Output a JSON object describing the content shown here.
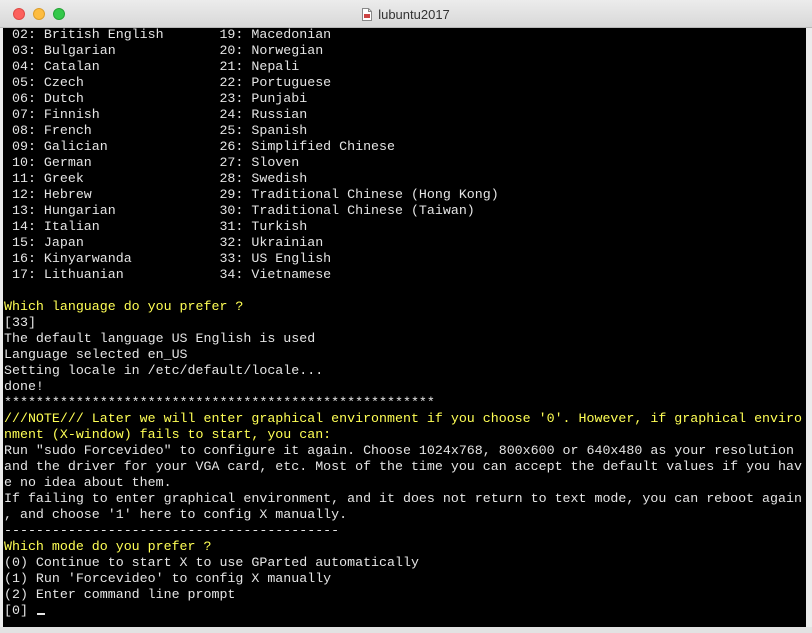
{
  "window": {
    "title": "lubuntu2017"
  },
  "terminal": {
    "lines": [
      {
        "text": " 02: British English       19: Macedonian",
        "color": "normal"
      },
      {
        "text": " 03: Bulgarian             20: Norwegian",
        "color": "normal"
      },
      {
        "text": " 04: Catalan               21: Nepali",
        "color": "normal"
      },
      {
        "text": " 05: Czech                 22: Portuguese",
        "color": "normal"
      },
      {
        "text": " 06: Dutch                 23: Punjabi",
        "color": "normal"
      },
      {
        "text": " 07: Finnish               24: Russian",
        "color": "normal"
      },
      {
        "text": " 08: French                25: Spanish",
        "color": "normal"
      },
      {
        "text": " 09: Galician              26: Simplified Chinese",
        "color": "normal"
      },
      {
        "text": " 10: German                27: Sloven",
        "color": "normal"
      },
      {
        "text": " 11: Greek                 28: Swedish",
        "color": "normal"
      },
      {
        "text": " 12: Hebrew                29: Traditional Chinese (Hong Kong)",
        "color": "normal"
      },
      {
        "text": " 13: Hungarian             30: Traditional Chinese (Taiwan)",
        "color": "normal"
      },
      {
        "text": " 14: Italian               31: Turkish",
        "color": "normal"
      },
      {
        "text": " 15: Japan                 32: Ukrainian",
        "color": "normal"
      },
      {
        "text": " 16: Kinyarwanda           33: US English",
        "color": "normal"
      },
      {
        "text": " 17: Lithuanian            34: Vietnamese",
        "color": "normal"
      },
      {
        "text": "",
        "color": "normal"
      },
      {
        "text": "Which language do you prefer ?",
        "color": "yellow"
      },
      {
        "text": "[33]",
        "color": "normal"
      },
      {
        "text": "The default language US English is used",
        "color": "normal"
      },
      {
        "text": "Language selected en_US",
        "color": "normal"
      },
      {
        "text": "Setting locale in /etc/default/locale...",
        "color": "normal"
      },
      {
        "text": "done!",
        "color": "normal"
      },
      {
        "text": "******************************************************",
        "color": "normal"
      },
      {
        "text": "///NOTE/// Later we will enter graphical environment if you choose '0'. However, if graphical enviro",
        "color": "yellow"
      },
      {
        "text": "nment (X-window) fails to start, you can:",
        "color": "yellow"
      },
      {
        "text": "Run \"sudo Forcevideo\" to configure it again. Choose 1024x768, 800x600 or 640x480 as your resolution",
        "color": "normal"
      },
      {
        "text": "and the driver for your VGA card, etc. Most of the time you can accept the default values if you hav",
        "color": "normal"
      },
      {
        "text": "e no idea about them.",
        "color": "normal"
      },
      {
        "text": "If failing to enter graphical environment, and it does not return to text mode, you can reboot again",
        "color": "normal"
      },
      {
        "text": ", and choose '1' here to config X manually.",
        "color": "normal"
      },
      {
        "text": "------------------------------------------",
        "color": "normal"
      },
      {
        "text": "Which mode do you prefer ?",
        "color": "yellow"
      },
      {
        "text": "(0) Continue to start X to use GParted automatically",
        "color": "normal"
      },
      {
        "text": "(1) Run 'Forcevideo' to config X manually",
        "color": "normal"
      },
      {
        "text": "(2) Enter command line prompt",
        "color": "normal"
      },
      {
        "text": "[0] ",
        "color": "normal"
      }
    ]
  },
  "colors": {
    "normal": "#e5e5e5",
    "yellow": "#ffff55",
    "background": "#000000"
  }
}
